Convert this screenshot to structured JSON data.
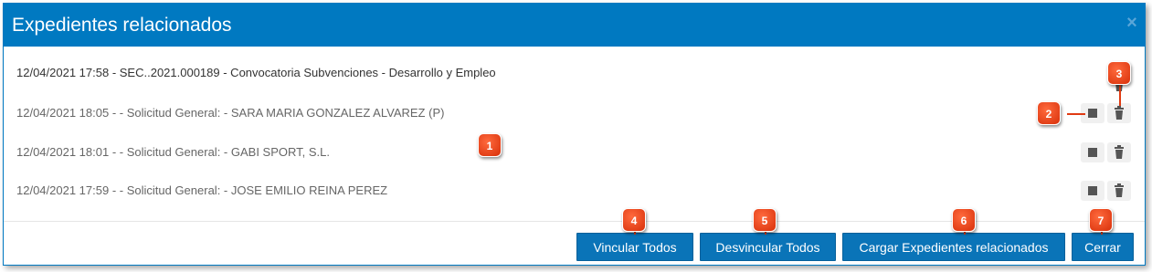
{
  "dialog": {
    "title": "Expedientes relacionados",
    "close_glyph": "×"
  },
  "main_record": {
    "text": "12/04/2021 17:58 - SEC..2021.000189 - Convocatoria Subvenciones - Desarrollo y Empleo"
  },
  "related": [
    {
      "text": "12/04/2021 18:05 - - Solicitud General: - SARA MARIA GONZALEZ ALVAREZ (P)"
    },
    {
      "text": "12/04/2021 18:01 - - Solicitud General: - GABI SPORT, S.L."
    },
    {
      "text": "12/04/2021 17:59 - - Solicitud General: - JOSE EMILIO REINA PEREZ"
    }
  ],
  "icons": {
    "link": "square-icon",
    "delete": "trash-icon"
  },
  "buttons": {
    "vincular": "Vincular Todos",
    "desvincular": "Desvincular Todos",
    "cargar": "Cargar Expedientes relacionados",
    "cerrar": "Cerrar"
  },
  "callouts": [
    "1",
    "2",
    "3",
    "4",
    "5",
    "6",
    "7"
  ],
  "colors": {
    "header": "#0079c1",
    "button": "#0a74b8",
    "callout": "#e03a12"
  }
}
